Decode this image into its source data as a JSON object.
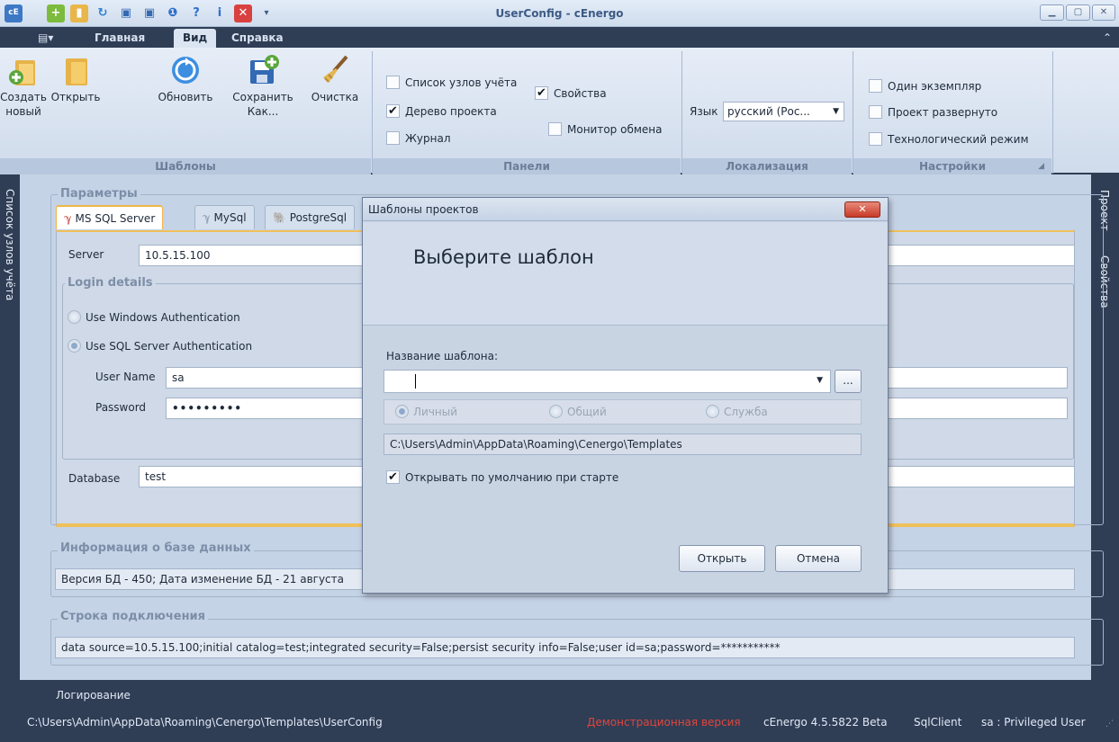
{
  "window": {
    "title": "UserConfig - cEnergo"
  },
  "ribbon_tabs": [
    "Главная",
    "Вид",
    "Справка"
  ],
  "groups": {
    "templates": {
      "label": "Шаблоны",
      "buttons": [
        {
          "label": "Создать\nновый",
          "icon": "new-folder-icon"
        },
        {
          "label": "Открыть",
          "icon": "open-folder-icon"
        },
        {
          "label": "Обновить",
          "icon": "refresh-icon"
        },
        {
          "label": "Сохранить\nКак...",
          "icon": "save-as-icon"
        },
        {
          "label": "Очистка",
          "icon": "broom-icon"
        }
      ]
    },
    "panels": {
      "label": "Панели",
      "items": [
        {
          "label": "Список узлов учёта",
          "checked": false
        },
        {
          "label": "Дерево проекта",
          "checked": true
        },
        {
          "label": "Журнал",
          "checked": false
        },
        {
          "label": "Свойства",
          "checked": true
        },
        {
          "label": "Монитор обмена",
          "checked": false
        }
      ]
    },
    "localization": {
      "label": "Локализация",
      "language_label": "Язык",
      "language_value": "русский (Рос..."
    },
    "settings": {
      "label": "Настройки",
      "items": [
        {
          "label": "Один экземпляр",
          "checked": false
        },
        {
          "label": "Проект развернуто",
          "checked": false
        },
        {
          "label": "Технологический режим",
          "checked": false
        }
      ]
    }
  },
  "left_sidebar": {
    "label": "Список узлов учёта"
  },
  "right_sidebar": {
    "items": [
      "Проект",
      "Свойства"
    ]
  },
  "params": {
    "title": "Параметры",
    "db_tabs": [
      "MS SQL Server",
      "MySql",
      "PostgreSql"
    ],
    "server_label": "Server",
    "server_value": "10.5.15.100",
    "login": {
      "title": "Login details",
      "windows_auth": "Use Windows Authentication",
      "sql_auth": "Use SQL Server Authentication",
      "username_label": "User Name",
      "username_value": "sa",
      "password_label": "Password",
      "password_value": "•••••••••"
    },
    "database_label": "Database",
    "database_value": "test"
  },
  "db_info": {
    "title": "Информация о базе данных",
    "value": "Версия БД - 450; Дата изменение БД - 21 августа"
  },
  "connection": {
    "title": "Строка подключения",
    "value": "data source=10.5.15.100;initial catalog=test;integrated security=False;persist security info=False;user id=sa;password=***********"
  },
  "status": {
    "logging": "Логирование",
    "path": "C:\\Users\\Admin\\AppData\\Roaming\\Cenergo\\Templates\\UserConfig",
    "demo": "Демонстрационная версия",
    "version": "cEnergo 4.5.5822 Beta",
    "client": "SqlClient",
    "user": "sa : Privileged User"
  },
  "dialog": {
    "title": "Шаблоны проектов",
    "heading": "Выберите шаблон",
    "name_label": "Название шаблона:",
    "name_value": "",
    "browse": "...",
    "options": [
      "Личный",
      "Общий",
      "Служба"
    ],
    "path": "C:\\Users\\Admin\\AppData\\Roaming\\Cenergo\\Templates",
    "open_default": "Открывать по умолчанию при старте",
    "open_default_checked": true,
    "ok": "Открыть",
    "cancel": "Отмена"
  }
}
